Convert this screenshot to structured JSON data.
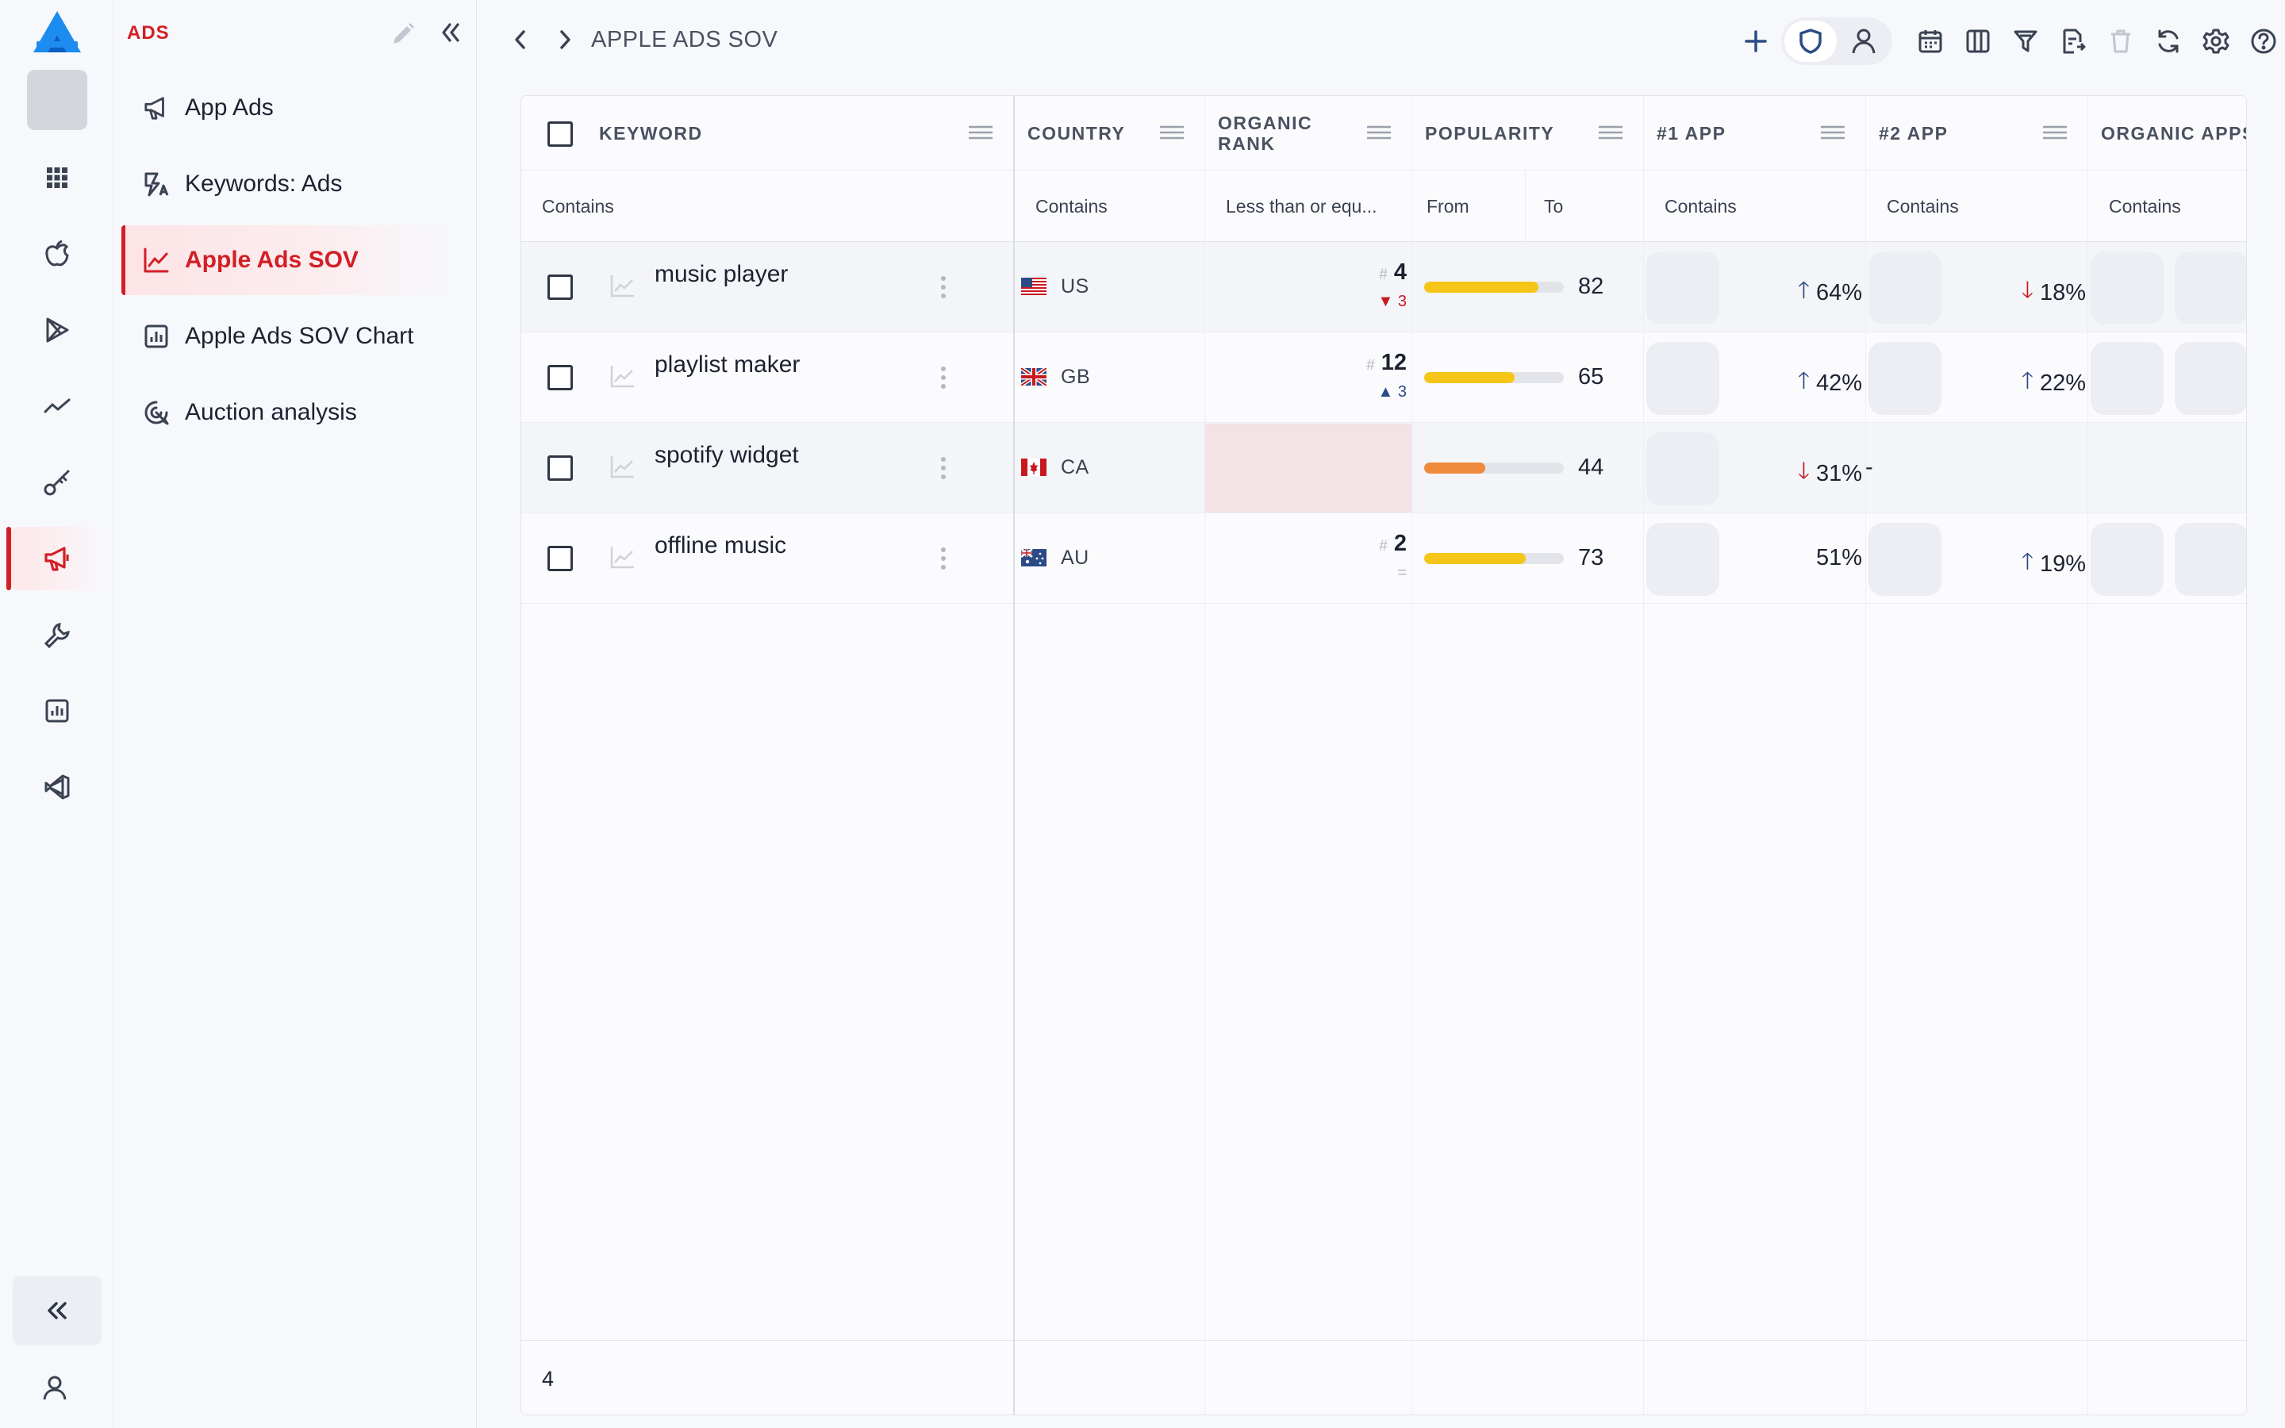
{
  "colors": {
    "accent": "#d21f26",
    "up": "#2c4b86",
    "down": "#c8181f",
    "yellow": "#f5c518",
    "orange": "#f08a3c",
    "empty_rank": "#f3e3e6"
  },
  "nav": {
    "section_title": "ADS",
    "items": [
      {
        "label": "App Ads",
        "icon": "megaphone-icon"
      },
      {
        "label": "Keywords: Ads",
        "icon": "keyword-ads-icon"
      },
      {
        "label": "Apple Ads SOV",
        "icon": "line-chart-icon",
        "active": true
      },
      {
        "label": "Apple Ads SOV Chart",
        "icon": "bar-chart-icon"
      },
      {
        "label": "Auction analysis",
        "icon": "target-icon"
      }
    ]
  },
  "header": {
    "breadcrumb": "APPLE ADS SOV"
  },
  "grid": {
    "columns": {
      "keyword": "KEYWORD",
      "country": "COUNTRY",
      "organic_rank_1": "ORGANIC",
      "organic_rank_2": "RANK",
      "popularity": "POPULARITY",
      "app1": "#1 APP",
      "app2": "#2 APP",
      "organic_apps": "ORGANIC APPS"
    },
    "filters": {
      "keyword": "Contains",
      "country": "Contains",
      "organic_rank": "Less than or equ...",
      "pop_from": "From",
      "pop_to": "To",
      "app1": "Contains",
      "app2": "Contains",
      "organic_apps": "Contains"
    },
    "rows": [
      {
        "keyword": "music player",
        "country": "US",
        "rank": "4",
        "rank_change": "3",
        "rank_dir": "down",
        "popularity": 82,
        "app1_pct": "64%",
        "app1_dir": "up",
        "app2_pct": "18%",
        "app2_dir": "down"
      },
      {
        "keyword": "playlist maker",
        "country": "GB",
        "rank": "12",
        "rank_change": "3",
        "rank_dir": "up",
        "popularity": 65,
        "app1_pct": "42%",
        "app1_dir": "up",
        "app2_pct": "22%",
        "app2_dir": "up"
      },
      {
        "keyword": "spotify widget",
        "country": "CA",
        "rank": "",
        "rank_change": "",
        "rank_dir": "none",
        "popularity": 44,
        "app1_pct": "31%",
        "app1_dir": "down",
        "app2_pct": "-",
        "app2_dir": "none"
      },
      {
        "keyword": "offline music",
        "country": "AU",
        "rank": "2",
        "rank_change": "=",
        "rank_dir": "same",
        "popularity": 73,
        "app1_pct": "51%",
        "app1_dir": "none",
        "app2_pct": "19%",
        "app2_dir": "up"
      }
    ],
    "row_count": "4"
  }
}
